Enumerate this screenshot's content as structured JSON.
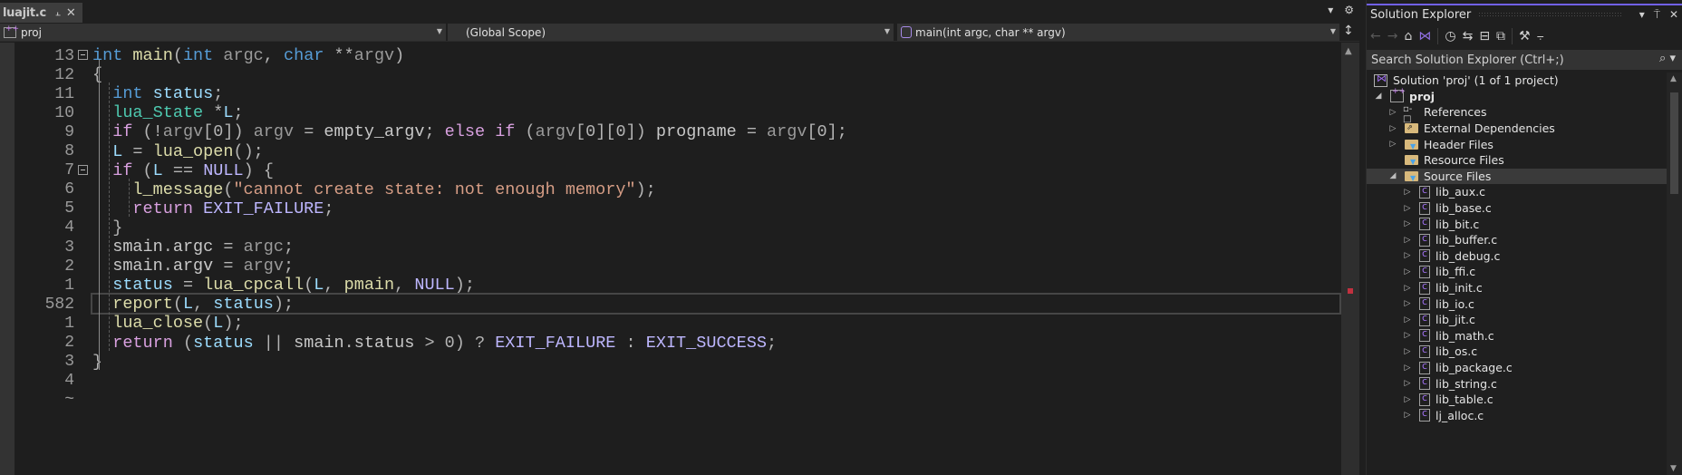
{
  "editor": {
    "tab": {
      "filename": "luajit.c",
      "pin_icon": "pin-icon",
      "close_icon": "close-icon"
    },
    "tabbar_actions": {
      "dropdown_icon": "chevron-down-icon",
      "settings_icon": "gear-icon"
    },
    "navbar": {
      "project": "proj",
      "scope": "(Global Scope)",
      "member": "main(int argc, char ** argv)",
      "split_icon": "split-editor-icon"
    },
    "relative_line_numbers": true,
    "current_line_number": "582",
    "lines": [
      {
        "ln": "13",
        "fold": true,
        "tokens": [
          [
            "kw",
            "int"
          ],
          [
            "pn",
            " "
          ],
          [
            "fn",
            "main"
          ],
          [
            "pn",
            "("
          ],
          [
            "kw",
            "int"
          ],
          [
            "pn",
            " "
          ],
          [
            "par",
            "argc"
          ],
          [
            "pn",
            ", "
          ],
          [
            "kw",
            "char"
          ],
          [
            "pn",
            " **"
          ],
          [
            "par",
            "argv"
          ],
          [
            "pn",
            ")"
          ]
        ]
      },
      {
        "ln": "12",
        "tokens": [
          [
            "pn",
            "{"
          ]
        ]
      },
      {
        "ln": "11",
        "tokens": [
          [
            "pn",
            "  "
          ],
          [
            "kw",
            "int"
          ],
          [
            "pn",
            " "
          ],
          [
            "var",
            "status"
          ],
          [
            "pn",
            ";"
          ]
        ]
      },
      {
        "ln": "10",
        "tokens": [
          [
            "pn",
            "  "
          ],
          [
            "ty",
            "lua_State"
          ],
          [
            "pn",
            " *"
          ],
          [
            "var",
            "L"
          ],
          [
            "pn",
            ";"
          ]
        ]
      },
      {
        "ln": "9",
        "tokens": [
          [
            "pn",
            "  "
          ],
          [
            "ctl",
            "if"
          ],
          [
            "pn",
            " (!"
          ],
          [
            "par",
            "argv"
          ],
          [
            "pn",
            "[0]) "
          ],
          [
            "par",
            "argv"
          ],
          [
            "pn",
            " = "
          ],
          [
            "glob",
            "empty_argv"
          ],
          [
            "pn",
            "; "
          ],
          [
            "ctl",
            "else"
          ],
          [
            "pn",
            " "
          ],
          [
            "ctl",
            "if"
          ],
          [
            "pn",
            " ("
          ],
          [
            "par",
            "argv"
          ],
          [
            "pn",
            "[0][0]) "
          ],
          [
            "glob",
            "progname"
          ],
          [
            "pn",
            " = "
          ],
          [
            "par",
            "argv"
          ],
          [
            "pn",
            "[0];"
          ]
        ]
      },
      {
        "ln": "8",
        "tokens": [
          [
            "pn",
            "  "
          ],
          [
            "var",
            "L"
          ],
          [
            "pn",
            " = "
          ],
          [
            "fn",
            "lua_open"
          ],
          [
            "pn",
            "();"
          ]
        ]
      },
      {
        "ln": "7",
        "fold": true,
        "tokens": [
          [
            "pn",
            "  "
          ],
          [
            "ctl",
            "if"
          ],
          [
            "pn",
            " ("
          ],
          [
            "var",
            "L"
          ],
          [
            "pn",
            " == "
          ],
          [
            "mac",
            "NULL"
          ],
          [
            "pn",
            ") {"
          ]
        ]
      },
      {
        "ln": "6",
        "tokens": [
          [
            "pn",
            "    "
          ],
          [
            "fn",
            "l_message"
          ],
          [
            "pn",
            "("
          ],
          [
            "str",
            "\"cannot create state: not enough memory\""
          ],
          [
            "pn",
            ");"
          ]
        ]
      },
      {
        "ln": "5",
        "tokens": [
          [
            "pn",
            "    "
          ],
          [
            "ctl",
            "return"
          ],
          [
            "pn",
            " "
          ],
          [
            "mac",
            "EXIT_FAILURE"
          ],
          [
            "pn",
            ";"
          ]
        ]
      },
      {
        "ln": "4",
        "tokens": [
          [
            "pn",
            "  }"
          ]
        ]
      },
      {
        "ln": "3",
        "tokens": [
          [
            "pn",
            "  "
          ],
          [
            "glob",
            "smain"
          ],
          [
            "pn",
            "."
          ],
          [
            "glob",
            "argc"
          ],
          [
            "pn",
            " = "
          ],
          [
            "par",
            "argc"
          ],
          [
            "pn",
            ";"
          ]
        ]
      },
      {
        "ln": "2",
        "tokens": [
          [
            "pn",
            "  "
          ],
          [
            "glob",
            "smain"
          ],
          [
            "pn",
            "."
          ],
          [
            "glob",
            "argv"
          ],
          [
            "pn",
            " = "
          ],
          [
            "par",
            "argv"
          ],
          [
            "pn",
            ";"
          ]
        ]
      },
      {
        "ln": "1",
        "tokens": [
          [
            "pn",
            "  "
          ],
          [
            "var",
            "status"
          ],
          [
            "pn",
            " = "
          ],
          [
            "fn",
            "lua_cpcall"
          ],
          [
            "pn",
            "("
          ],
          [
            "var",
            "L"
          ],
          [
            "pn",
            ", "
          ],
          [
            "fn",
            "pmain"
          ],
          [
            "pn",
            ", "
          ],
          [
            "mac",
            "NULL"
          ],
          [
            "pn",
            ");"
          ]
        ]
      },
      {
        "ln": "582",
        "current": true,
        "tokens": [
          [
            "pn",
            "  "
          ],
          [
            "fn",
            "report"
          ],
          [
            "pn",
            "("
          ],
          [
            "var",
            "L"
          ],
          [
            "pn",
            ", "
          ],
          [
            "var",
            "status"
          ],
          [
            "pn",
            ");"
          ]
        ]
      },
      {
        "ln": "1",
        "tokens": [
          [
            "pn",
            "  "
          ],
          [
            "fn",
            "lua_close"
          ],
          [
            "pn",
            "("
          ],
          [
            "var",
            "L"
          ],
          [
            "pn",
            ");"
          ]
        ]
      },
      {
        "ln": "2",
        "tokens": [
          [
            "pn",
            "  "
          ],
          [
            "ctl",
            "return"
          ],
          [
            "pn",
            " ("
          ],
          [
            "var",
            "status"
          ],
          [
            "pn",
            " || "
          ],
          [
            "glob",
            "smain"
          ],
          [
            "pn",
            "."
          ],
          [
            "glob",
            "status"
          ],
          [
            "pn",
            " > 0) ? "
          ],
          [
            "mac",
            "EXIT_FAILURE"
          ],
          [
            "pn",
            " : "
          ],
          [
            "mac",
            "EXIT_SUCCESS"
          ],
          [
            "pn",
            ";"
          ]
        ]
      },
      {
        "ln": "3",
        "tokens": [
          [
            "pn",
            "}"
          ]
        ]
      },
      {
        "ln": "4",
        "tokens": []
      },
      {
        "ln": "~",
        "tokens": []
      }
    ],
    "scrollbar": {
      "error_marker_color": "#c1313f"
    }
  },
  "solution_explorer": {
    "title": "Solution Explorer",
    "title_controls": {
      "dropdown": "▾",
      "pin": "⍑",
      "close": "✕"
    },
    "toolbar": [
      {
        "name": "back-icon",
        "glyph": "←",
        "dim": true
      },
      {
        "name": "forward-icon",
        "glyph": "→",
        "dim": true
      },
      {
        "name": "home-icon",
        "glyph": "⌂"
      },
      {
        "name": "switch-views-icon",
        "glyph": "⋈"
      },
      {
        "name": "pending-changes-filter-icon",
        "glyph": "◷"
      },
      {
        "name": "sync-with-document-icon",
        "glyph": "⇆"
      },
      {
        "name": "collapse-all-icon",
        "glyph": "⊟"
      },
      {
        "name": "show-all-files-icon",
        "glyph": "⧉"
      },
      {
        "name": "properties-icon",
        "glyph": "⚒"
      },
      {
        "name": "preview-selected-icon",
        "glyph": "⨪"
      }
    ],
    "search_placeholder": "Search Solution Explorer (Ctrl+;)",
    "tree": [
      {
        "label": "Solution 'proj' (1 of 1 project)",
        "level": 0,
        "icon": "solution",
        "expander": ""
      },
      {
        "label": "proj",
        "level": 1,
        "icon": "project",
        "expander": "expanded",
        "bold": true
      },
      {
        "label": "References",
        "level": 2,
        "icon": "references",
        "expander": "collapsed"
      },
      {
        "label": "External Dependencies",
        "level": 2,
        "icon": "external-deps",
        "expander": "collapsed"
      },
      {
        "label": "Header Files",
        "level": 2,
        "icon": "filter-folder",
        "expander": "collapsed"
      },
      {
        "label": "Resource Files",
        "level": 2,
        "icon": "filter-folder",
        "expander": ""
      },
      {
        "label": "Source Files",
        "level": 2,
        "icon": "filter-folder",
        "expander": "expanded",
        "selected": true
      },
      {
        "label": "lib_aux.c",
        "level": 3,
        "icon": "c-file",
        "expander": "collapsed"
      },
      {
        "label": "lib_base.c",
        "level": 3,
        "icon": "c-file",
        "expander": "collapsed"
      },
      {
        "label": "lib_bit.c",
        "level": 3,
        "icon": "c-file",
        "expander": "collapsed"
      },
      {
        "label": "lib_buffer.c",
        "level": 3,
        "icon": "c-file",
        "expander": "collapsed"
      },
      {
        "label": "lib_debug.c",
        "level": 3,
        "icon": "c-file",
        "expander": "collapsed"
      },
      {
        "label": "lib_ffi.c",
        "level": 3,
        "icon": "c-file",
        "expander": "collapsed"
      },
      {
        "label": "lib_init.c",
        "level": 3,
        "icon": "c-file",
        "expander": "collapsed"
      },
      {
        "label": "lib_io.c",
        "level": 3,
        "icon": "c-file",
        "expander": "collapsed"
      },
      {
        "label": "lib_jit.c",
        "level": 3,
        "icon": "c-file",
        "expander": "collapsed"
      },
      {
        "label": "lib_math.c",
        "level": 3,
        "icon": "c-file",
        "expander": "collapsed"
      },
      {
        "label": "lib_os.c",
        "level": 3,
        "icon": "c-file",
        "expander": "collapsed"
      },
      {
        "label": "lib_package.c",
        "level": 3,
        "icon": "c-file",
        "expander": "collapsed"
      },
      {
        "label": "lib_string.c",
        "level": 3,
        "icon": "c-file",
        "expander": "collapsed"
      },
      {
        "label": "lib_table.c",
        "level": 3,
        "icon": "c-file",
        "expander": "collapsed"
      },
      {
        "label": "lj_alloc.c",
        "level": 3,
        "icon": "c-file",
        "expander": "collapsed"
      }
    ]
  }
}
